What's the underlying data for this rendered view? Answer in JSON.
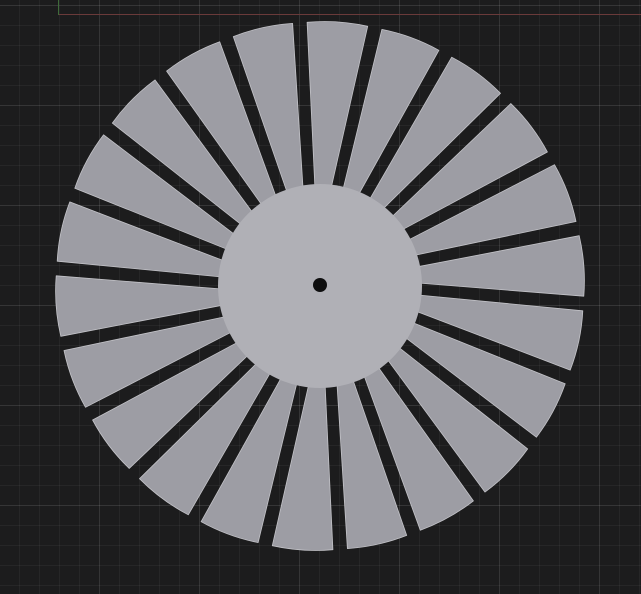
{
  "viewport": {
    "background": "#1c1c1d",
    "grid": true,
    "x_axis_color": "#6a3a3a",
    "y_axis_color": "#3f6b3a"
  },
  "model": {
    "object": "fan-impeller",
    "blade_count": 22,
    "blade_color": "#9d9da4",
    "blade_edge_color": "#c3c3c8",
    "hub_color": "#b0b0b6",
    "hole_color": "#0e0e0f"
  }
}
